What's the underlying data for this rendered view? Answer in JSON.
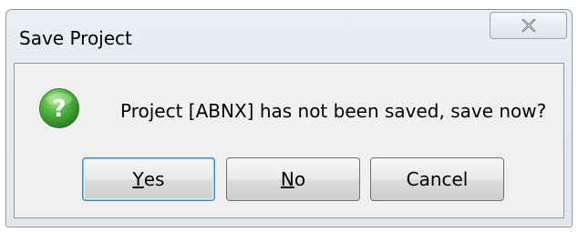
{
  "dialog": {
    "title": "Save Project",
    "message": "Project [ABNX] has not been saved, save now?",
    "icon": "question-icon",
    "close_icon": "close-icon"
  },
  "buttons": {
    "yes": {
      "mnemonic": "Y",
      "rest": "es"
    },
    "no": {
      "mnemonic": "N",
      "rest": "o"
    },
    "cancel": {
      "label": "Cancel"
    }
  },
  "colors": {
    "icon_green": "#4cae3c",
    "default_button_border": "#3c7fb1"
  }
}
